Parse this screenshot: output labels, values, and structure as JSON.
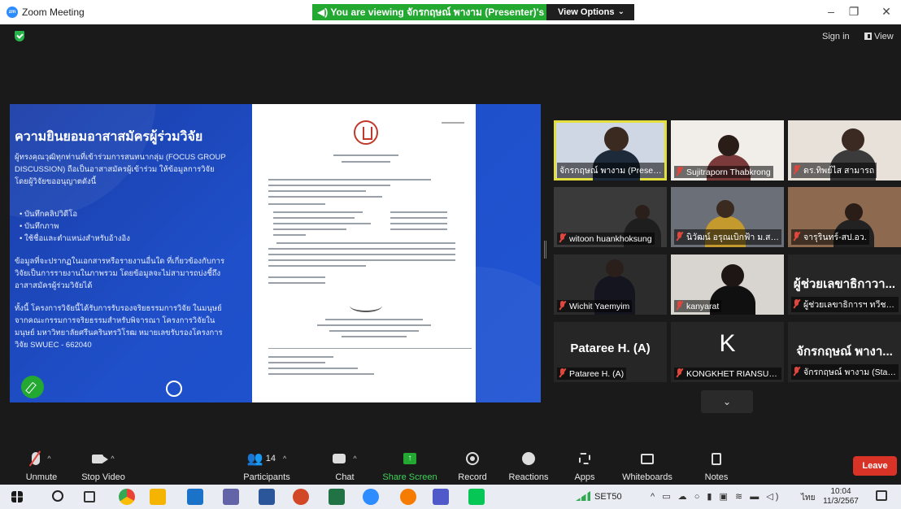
{
  "window": {
    "app_title": "Zoom Meeting",
    "banner_text": "You are viewing จักรกฤษณ์ พางาม (Presenter)'s screen",
    "view_options_label": "View Options",
    "sign_in_label": "Sign in",
    "view_label": "View"
  },
  "shared_slide": {
    "title": "ความยินยอมอาสาสมัครผู้ร่วมวิจัย",
    "paragraph1": "ผู้ทรงคุณวุฒิทุกท่านที่เข้าร่วมการสนทนากลุ่ม (FOCUS GROUP DISCUSSION) ถือเป็นอาสาสมัครผู้เข้าร่วม ให้ข้อมูลการวิจัย โดยผู้วิจัยขออนุญาตดังนี้",
    "bullets": [
      "บันทึกคลิปวิดีโอ",
      "บันทึกภาพ",
      "ใช้ชื่อและตำแหน่งสำหรับอ้างอิง"
    ],
    "paragraph2": "ข้อมูลที่จะปรากฏในเอกสารหรือรายงานอื่นใด ที่เกี่ยวข้องกับการวิจัยเป็นการรายงานในภาพรวม โดยข้อมูลจะไม่สามารถบ่งชี้ถึงอาสาสมัครผู้ร่วมวิจัยได้",
    "paragraph3": "ทั้งนี้ โครงการวิจัยนี้ได้รับการรับรองจริยธรรมการวิจัย ในมนุษย์จากคณะกรรมการจริยธรรมสำหรับพิจารณา โครงการวิจัยในมนุษย์ มหาวิทยาลัยศรีนครินทรวิโรฒ หมายเลขรับรองโครงการวิจัย SWUEC - 662040"
  },
  "participants_grid": [
    {
      "name": "จักรกฤษณ์ พางาม (Presenter)",
      "muted": false,
      "kind": "video",
      "active": true
    },
    {
      "name": "Sujitraporn Thabkrong",
      "muted": true,
      "kind": "video"
    },
    {
      "name": "ดร.ทิพย์ไส สามารถ",
      "muted": true,
      "kind": "video"
    },
    {
      "name": "witoon huankhoksung",
      "muted": true,
      "kind": "video"
    },
    {
      "name": "นิวัฒน์ อรุณเบิกฟ้า ม.สงขลา",
      "muted": true,
      "kind": "video"
    },
    {
      "name": "จารุรินทร์-สป.อว.",
      "muted": true,
      "kind": "video"
    },
    {
      "name": "Wichit Yaemyim",
      "muted": true,
      "kind": "video"
    },
    {
      "name": "kanyarat",
      "muted": true,
      "kind": "video"
    },
    {
      "name": "ผู้ช่วยเลขาธิการฯ ทวีชาติ ...",
      "muted": true,
      "kind": "text",
      "display": "ผู้ช่วยเลขาธิกาวา..."
    },
    {
      "name": "Pataree H. (A)",
      "muted": true,
      "kind": "text",
      "display": "Pataree H. (A)"
    },
    {
      "name": "KONGKHET RIANSUW...",
      "muted": true,
      "kind": "text",
      "display": "K"
    },
    {
      "name": "จักรกฤษณ์ พางาม (Stand...",
      "muted": true,
      "kind": "text",
      "display": "จักรกฤษณ์ พางา..."
    }
  ],
  "toolbar": {
    "unmute": "Unmute",
    "stop_video": "Stop Video",
    "participants": "Participants",
    "participants_count": "14",
    "chat": "Chat",
    "share_screen": "Share Screen",
    "record": "Record",
    "reactions": "Reactions",
    "apps": "Apps",
    "whiteboards": "Whiteboards",
    "notes": "Notes",
    "leave": "Leave"
  },
  "taskbar": {
    "stock_label": "SET50",
    "language": "ไทย",
    "time": "10:04",
    "date": "11/3/2567"
  },
  "colors": {
    "zoom_blue": "#2d8cff",
    "banner_green": "#23a832",
    "leave_red": "#d93226",
    "active_speaker": "#e2df3f",
    "slide_blue": "#1f4fc9"
  }
}
